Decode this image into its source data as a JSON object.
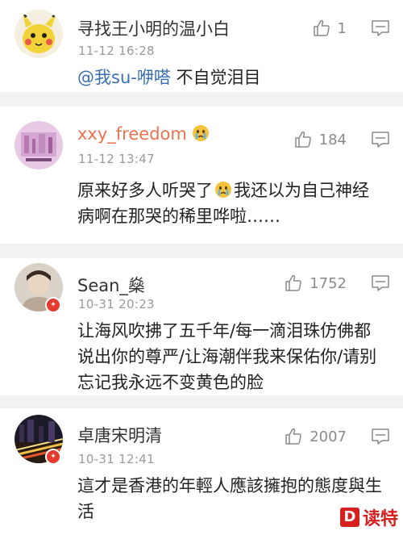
{
  "comments": [
    {
      "username": "寻找王小明的温小白",
      "time": "11-12 16:28",
      "mention": "@我su-咿嗒",
      "text": " 不自觉泪目",
      "likes": "1",
      "avatar": "yellow-cartoon-avatar"
    },
    {
      "username": "xxy_freedom",
      "time": "11-12 13:47",
      "text_before": "原来好多人听哭了",
      "text_after": "我还以为自己神经病啊在那哭的稀里哗啦……",
      "likes": "184",
      "avatar": "pink-photo-avatar"
    },
    {
      "username": "Sean_燊",
      "time": "10-31 20:23",
      "text": "让海风吹拂了五千年/每一滴泪珠仿佛都说出你的尊严/让海潮伴我来保佑你/请别忘记我永远不变黄色的脸",
      "likes": "1752",
      "avatar": "portrait-avatar"
    },
    {
      "username": "卓唐宋明清",
      "time": "10-31 12:41",
      "text": "這才是香港的年輕人應該擁抱的態度與生活",
      "likes": "2007",
      "avatar": "city-night-avatar"
    }
  ],
  "watermark": {
    "logo": "D",
    "text": "读特"
  },
  "colors": {
    "username_vip": "#eb7350",
    "mention": "#3a6fb0",
    "badge": "#e63a2e"
  }
}
